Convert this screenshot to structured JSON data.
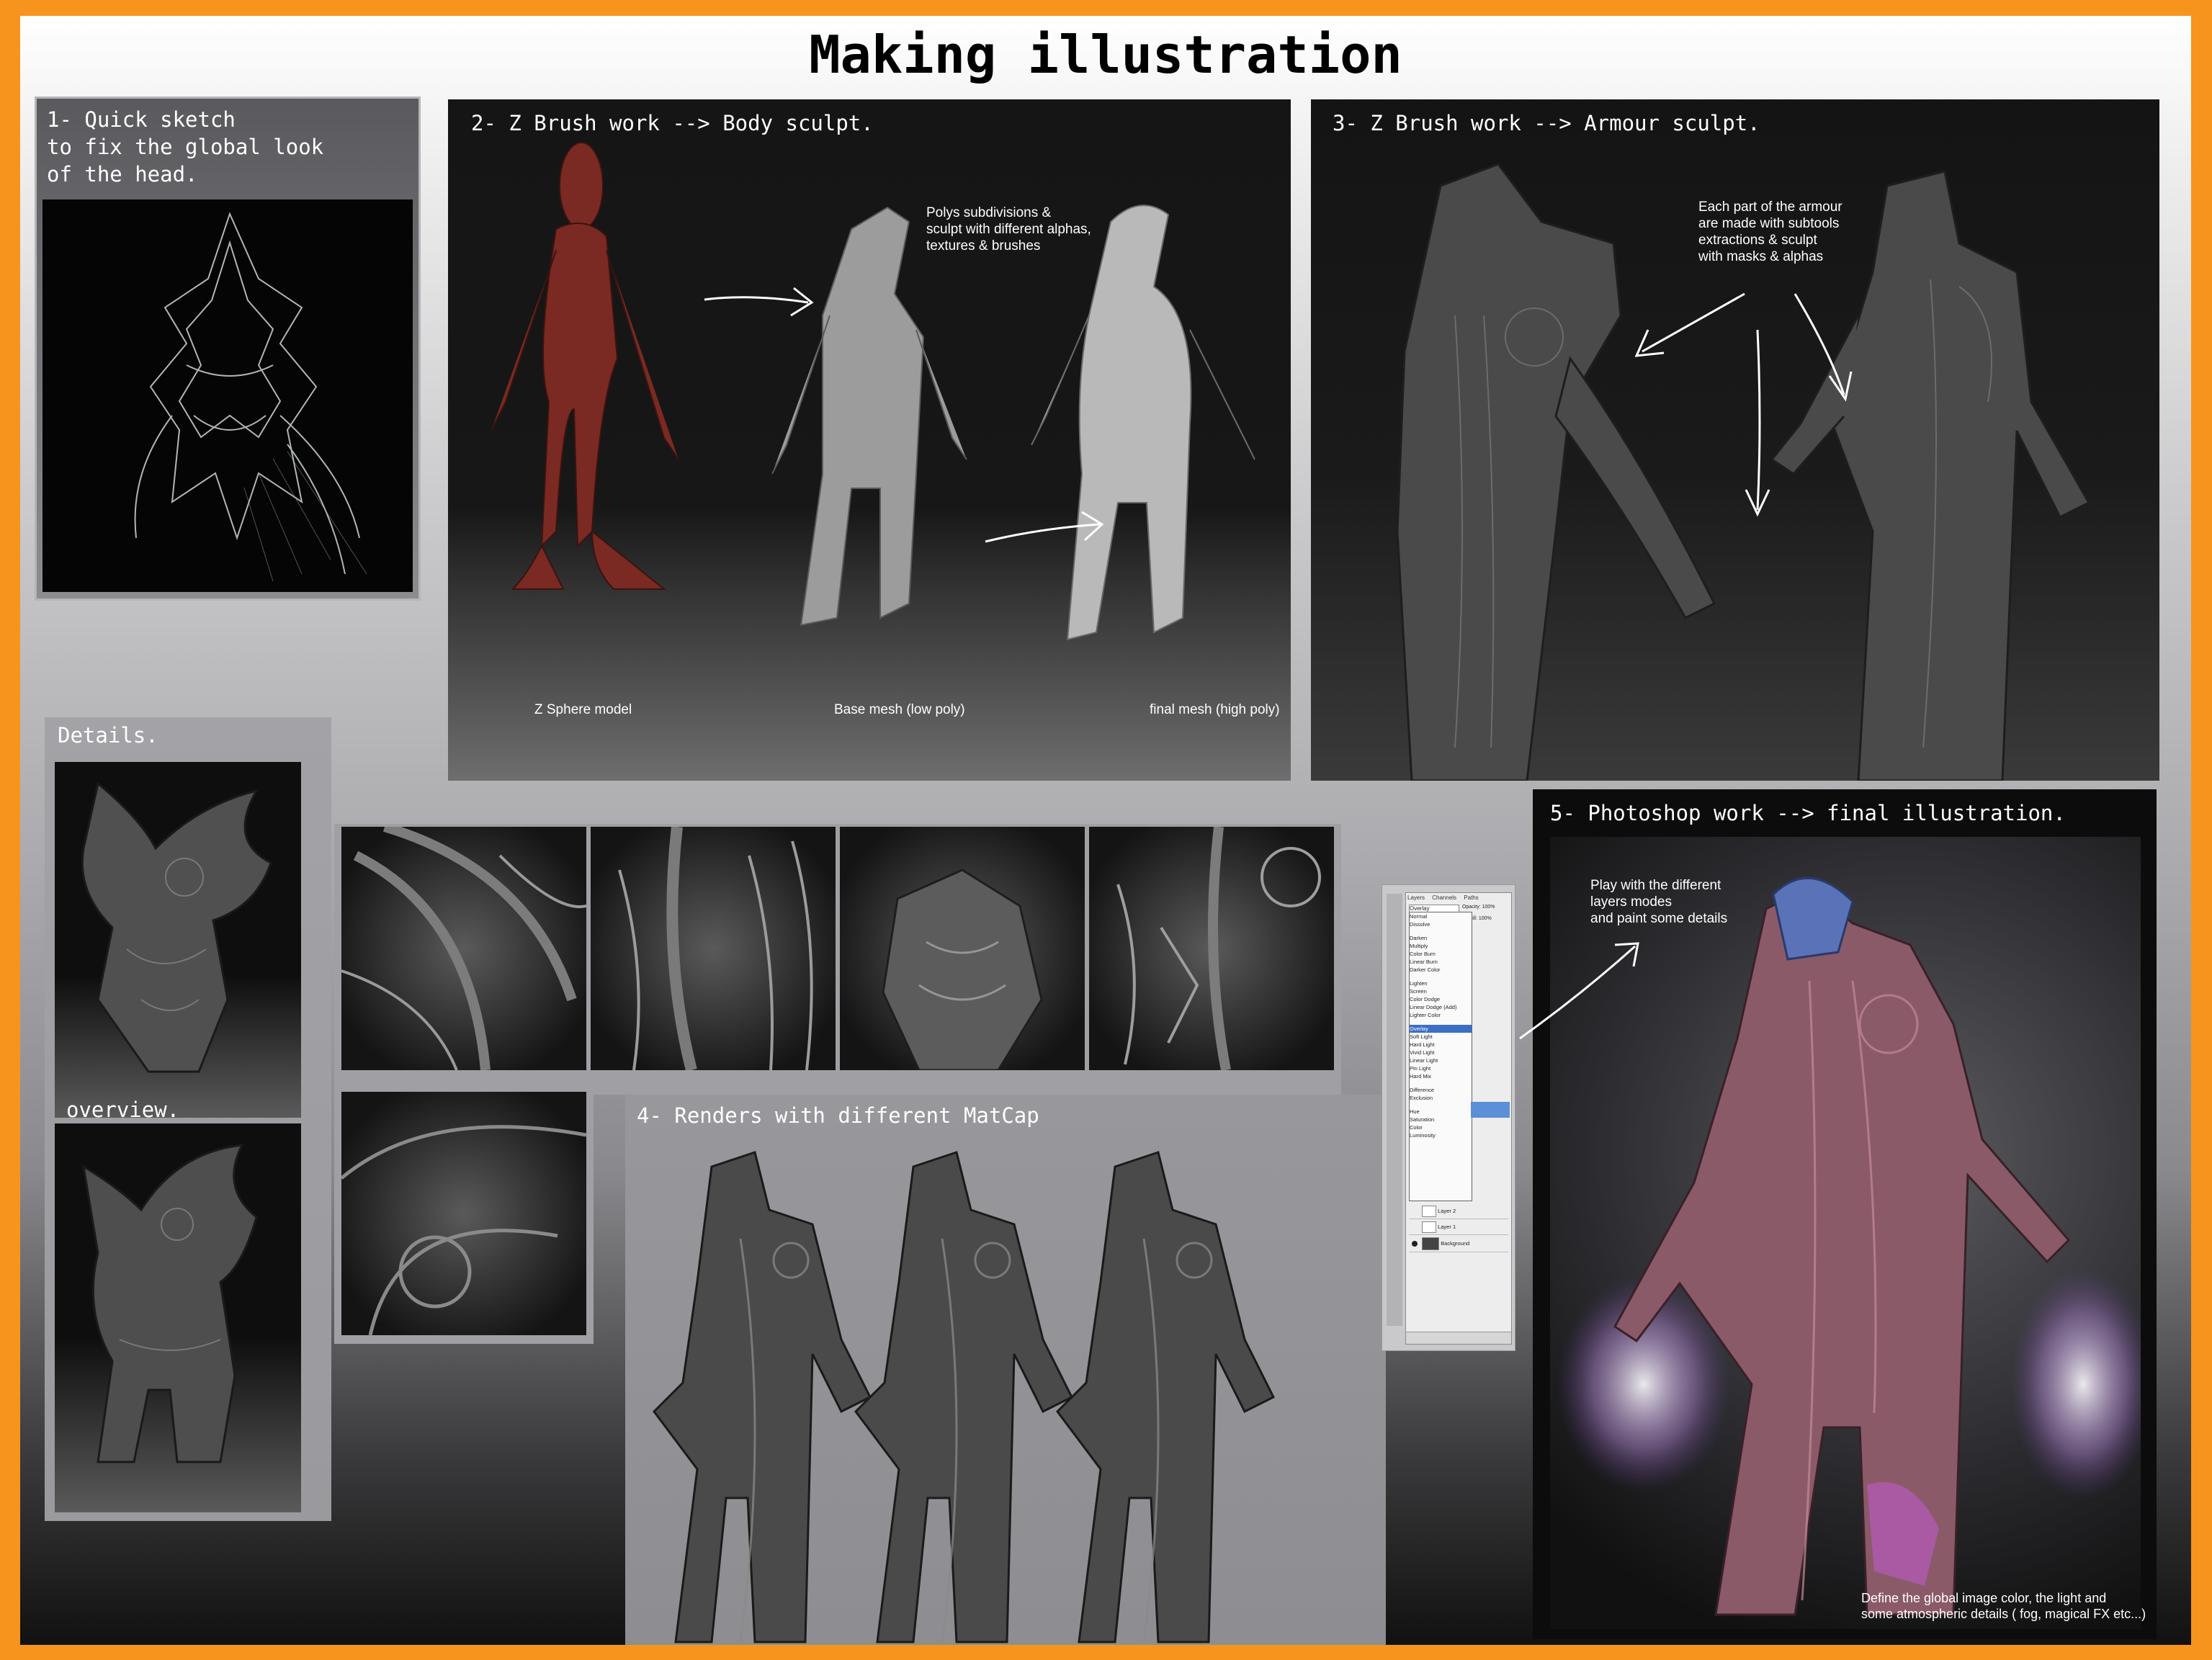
{
  "title": "Making illustration",
  "step1": {
    "label": "1- Quick sketch\nto fix the global look\nof the head."
  },
  "step2": {
    "label": "2- Z Brush work --> Body sculpt.",
    "note": "Polys subdivisions &\nsculpt with different alphas,\ntextures & brushes",
    "captions": [
      "Z Sphere model",
      "Base mesh (low poly)",
      "final mesh (high poly)"
    ]
  },
  "step3": {
    "label": "3- Z Brush work --> Armour sculpt.",
    "note": "Each part of the armour\nare made with subtools\nextractions & sculpt\nwith masks & alphas"
  },
  "details": {
    "label": "Details.",
    "overview_label": "overview."
  },
  "step4": {
    "label": "4- Renders with different MatCap"
  },
  "step5": {
    "label": "5- Photoshop work --> final illustration.",
    "note_top": "Play with the different\nlayers modes\nand paint some details",
    "note_bottom": "Define the global image color, the light and\nsome atmospheric details ( fog, magical FX etc...)"
  },
  "layers_panel": {
    "tabs": [
      "Layers",
      "Channels",
      "Paths"
    ],
    "blend_mode": "Overlay",
    "opacity": "Opacity: 100%",
    "fill": "Fill: 100%",
    "modes": [
      "Normal",
      "Dissolve",
      "Darken",
      "Multiply",
      "Color Burn",
      "Linear Burn",
      "Darker Color",
      "Lighten",
      "Screen",
      "Color Dodge",
      "Linear Dodge (Add)",
      "Lighter Color",
      "Overlay",
      "Soft Light",
      "Hard Light",
      "Vivid Light",
      "Linear Light",
      "Pin Light",
      "Hard Mix",
      "Difference",
      "Exclusion",
      "Hue",
      "Saturation",
      "Color",
      "Luminosity"
    ],
    "layers": [
      "Layer 2",
      "Layer 1",
      "Background"
    ]
  },
  "colors": {
    "border": "#f7941d",
    "stage": "#151515",
    "label_text": "#ffffff"
  }
}
